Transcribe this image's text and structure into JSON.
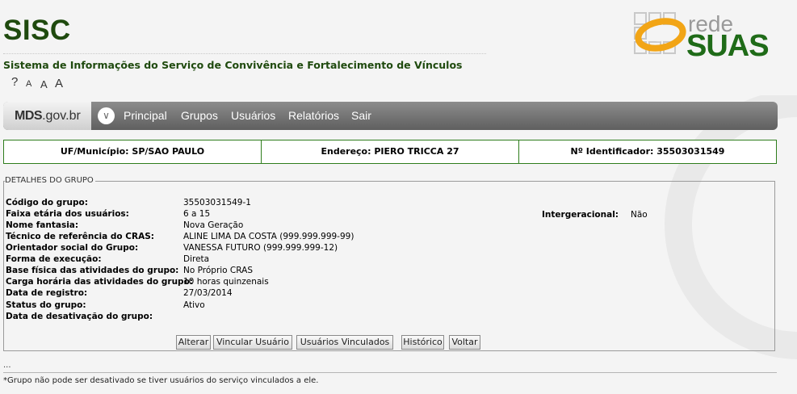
{
  "header": {
    "title": "SISC",
    "subtitle": "Sistema de Informações do Serviço de Convivência e Fortalecimento de Vínculos",
    "font_tools": {
      "help": "?",
      "small": "A",
      "medium": "A",
      "large": "A"
    },
    "logo": {
      "word_top": "rede",
      "word_bottom": "SUAS"
    }
  },
  "navbar": {
    "brand_bold": "MDS",
    "brand_rest": ".gov.br",
    "items": [
      "Principal",
      "Grupos",
      "Usuários",
      "Relatórios",
      "Sair"
    ]
  },
  "info_bar": {
    "uf": "UF/Município: SP/SAO PAULO",
    "endereco": "Endereço: PIERO TRICCA 27",
    "identificador": "Nº Identificador: 35503031549"
  },
  "details": {
    "legend": "DETALHES DO GRUPO",
    "fields": [
      {
        "label": "Código do grupo:",
        "value": "35503031549-1"
      },
      {
        "label": "Faixa etária dos usuários:",
        "value": "6 a 15"
      },
      {
        "label": "Nome fantasia:",
        "value": "Nova Geração"
      },
      {
        "label": "Técnico de referência do CRAS:",
        "value": "ALINE LIMA DA COSTA (999.999.999-99)"
      },
      {
        "label": "Orientador social do Grupo:",
        "value": "VANESSA FUTURO (999.999.999-12)"
      },
      {
        "label": "Forma de execução:",
        "value": "Direta"
      },
      {
        "label": "Base física das atividades do grupo:",
        "value": "No Próprio CRAS"
      },
      {
        "label": "Carga horária das atividades do grupo:",
        "value": "10 horas quinzenais"
      },
      {
        "label": "Data de registro:",
        "value": "27/03/2014"
      },
      {
        "label": "Status do grupo:",
        "value": "Ativo"
      },
      {
        "label": "Data de desativação do grupo:",
        "value": ""
      }
    ],
    "intergeracional": {
      "label": "Intergeracional:",
      "value": "Não"
    }
  },
  "buttons": {
    "alterar": "Alterar",
    "vincular": "Vincular Usuário",
    "vinculados": "Usuários Vinculados",
    "historico": "Histórico",
    "voltar": "Voltar"
  },
  "footer": {
    "dots": "...",
    "note": "*Grupo não pode ser desativado se tiver usuários do serviço vinculados a ele."
  },
  "colors": {
    "brand_green": "#1f4a0e",
    "logo_green": "#1f6b18",
    "logo_orange": "#f2a516",
    "border_green": "#2e7d1c"
  }
}
